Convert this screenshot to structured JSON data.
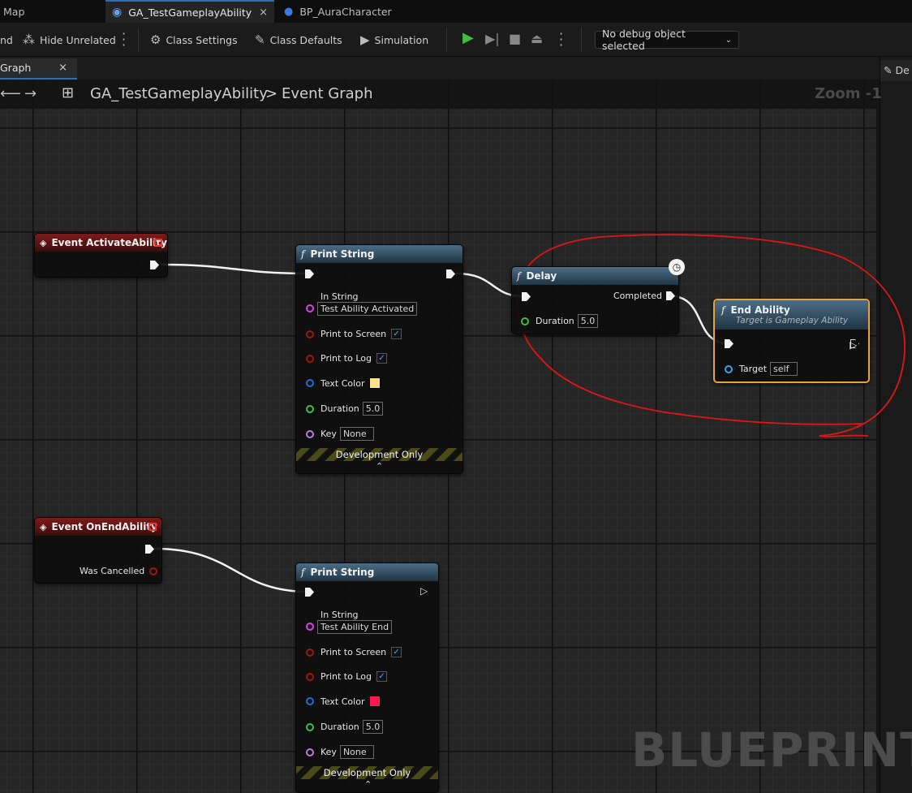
{
  "tabs": [
    {
      "label": "Map"
    },
    {
      "label": "GA_TestGameplayAbility",
      "close": "×"
    },
    {
      "label": "BP_AuraCharacter"
    }
  ],
  "toolbar": {
    "partial_left": "nd",
    "hide_unrelated": "Hide Unrelated",
    "class_settings": "Class Settings",
    "class_defaults": "Class Defaults",
    "simulation": "Simulation",
    "debug_object": "No debug object selected"
  },
  "graph_tab": {
    "label": "Graph",
    "close": "×"
  },
  "right_panel": {
    "label": "De"
  },
  "breadcrumb": {
    "blueprint": "GA_TestGameplayAbility",
    "separator": ">",
    "graph": "Event Graph"
  },
  "zoom": "Zoom -1",
  "watermark": "BLUEPRINT",
  "nodes": {
    "event_activate": {
      "title": "Event ActivateAbility"
    },
    "print1": {
      "title": "Print String",
      "in_string_label": "In String",
      "in_string_value": "Test Ability Activated",
      "print_screen": "Print to Screen",
      "print_log": "Print to Log",
      "text_color": "Text Color",
      "text_color_value": "#ffe28a",
      "duration": "Duration",
      "duration_value": "5.0",
      "key": "Key",
      "key_value": "None",
      "dev_only": "Development Only"
    },
    "delay": {
      "title": "Delay",
      "completed": "Completed",
      "duration": "Duration",
      "duration_value": "5.0"
    },
    "end_ability": {
      "title": "End Ability",
      "subtitle": "Target is Gameplay Ability",
      "target": "Target",
      "target_value": "self"
    },
    "event_end": {
      "title": "Event OnEndAbility",
      "was_cancelled": "Was Cancelled"
    },
    "print2": {
      "title": "Print String",
      "in_string_label": "In String",
      "in_string_value": "Test Ability End",
      "print_screen": "Print to Screen",
      "print_log": "Print to Log",
      "text_color": "Text Color",
      "text_color_value": "#ff1a4e",
      "duration": "Duration",
      "duration_value": "5.0",
      "key": "Key",
      "key_value": "None",
      "dev_only": "Development Only"
    }
  },
  "colors": {
    "accent": "#2a6fbf",
    "selection_outline": "#e8a33a",
    "annotation": "#e01515"
  }
}
